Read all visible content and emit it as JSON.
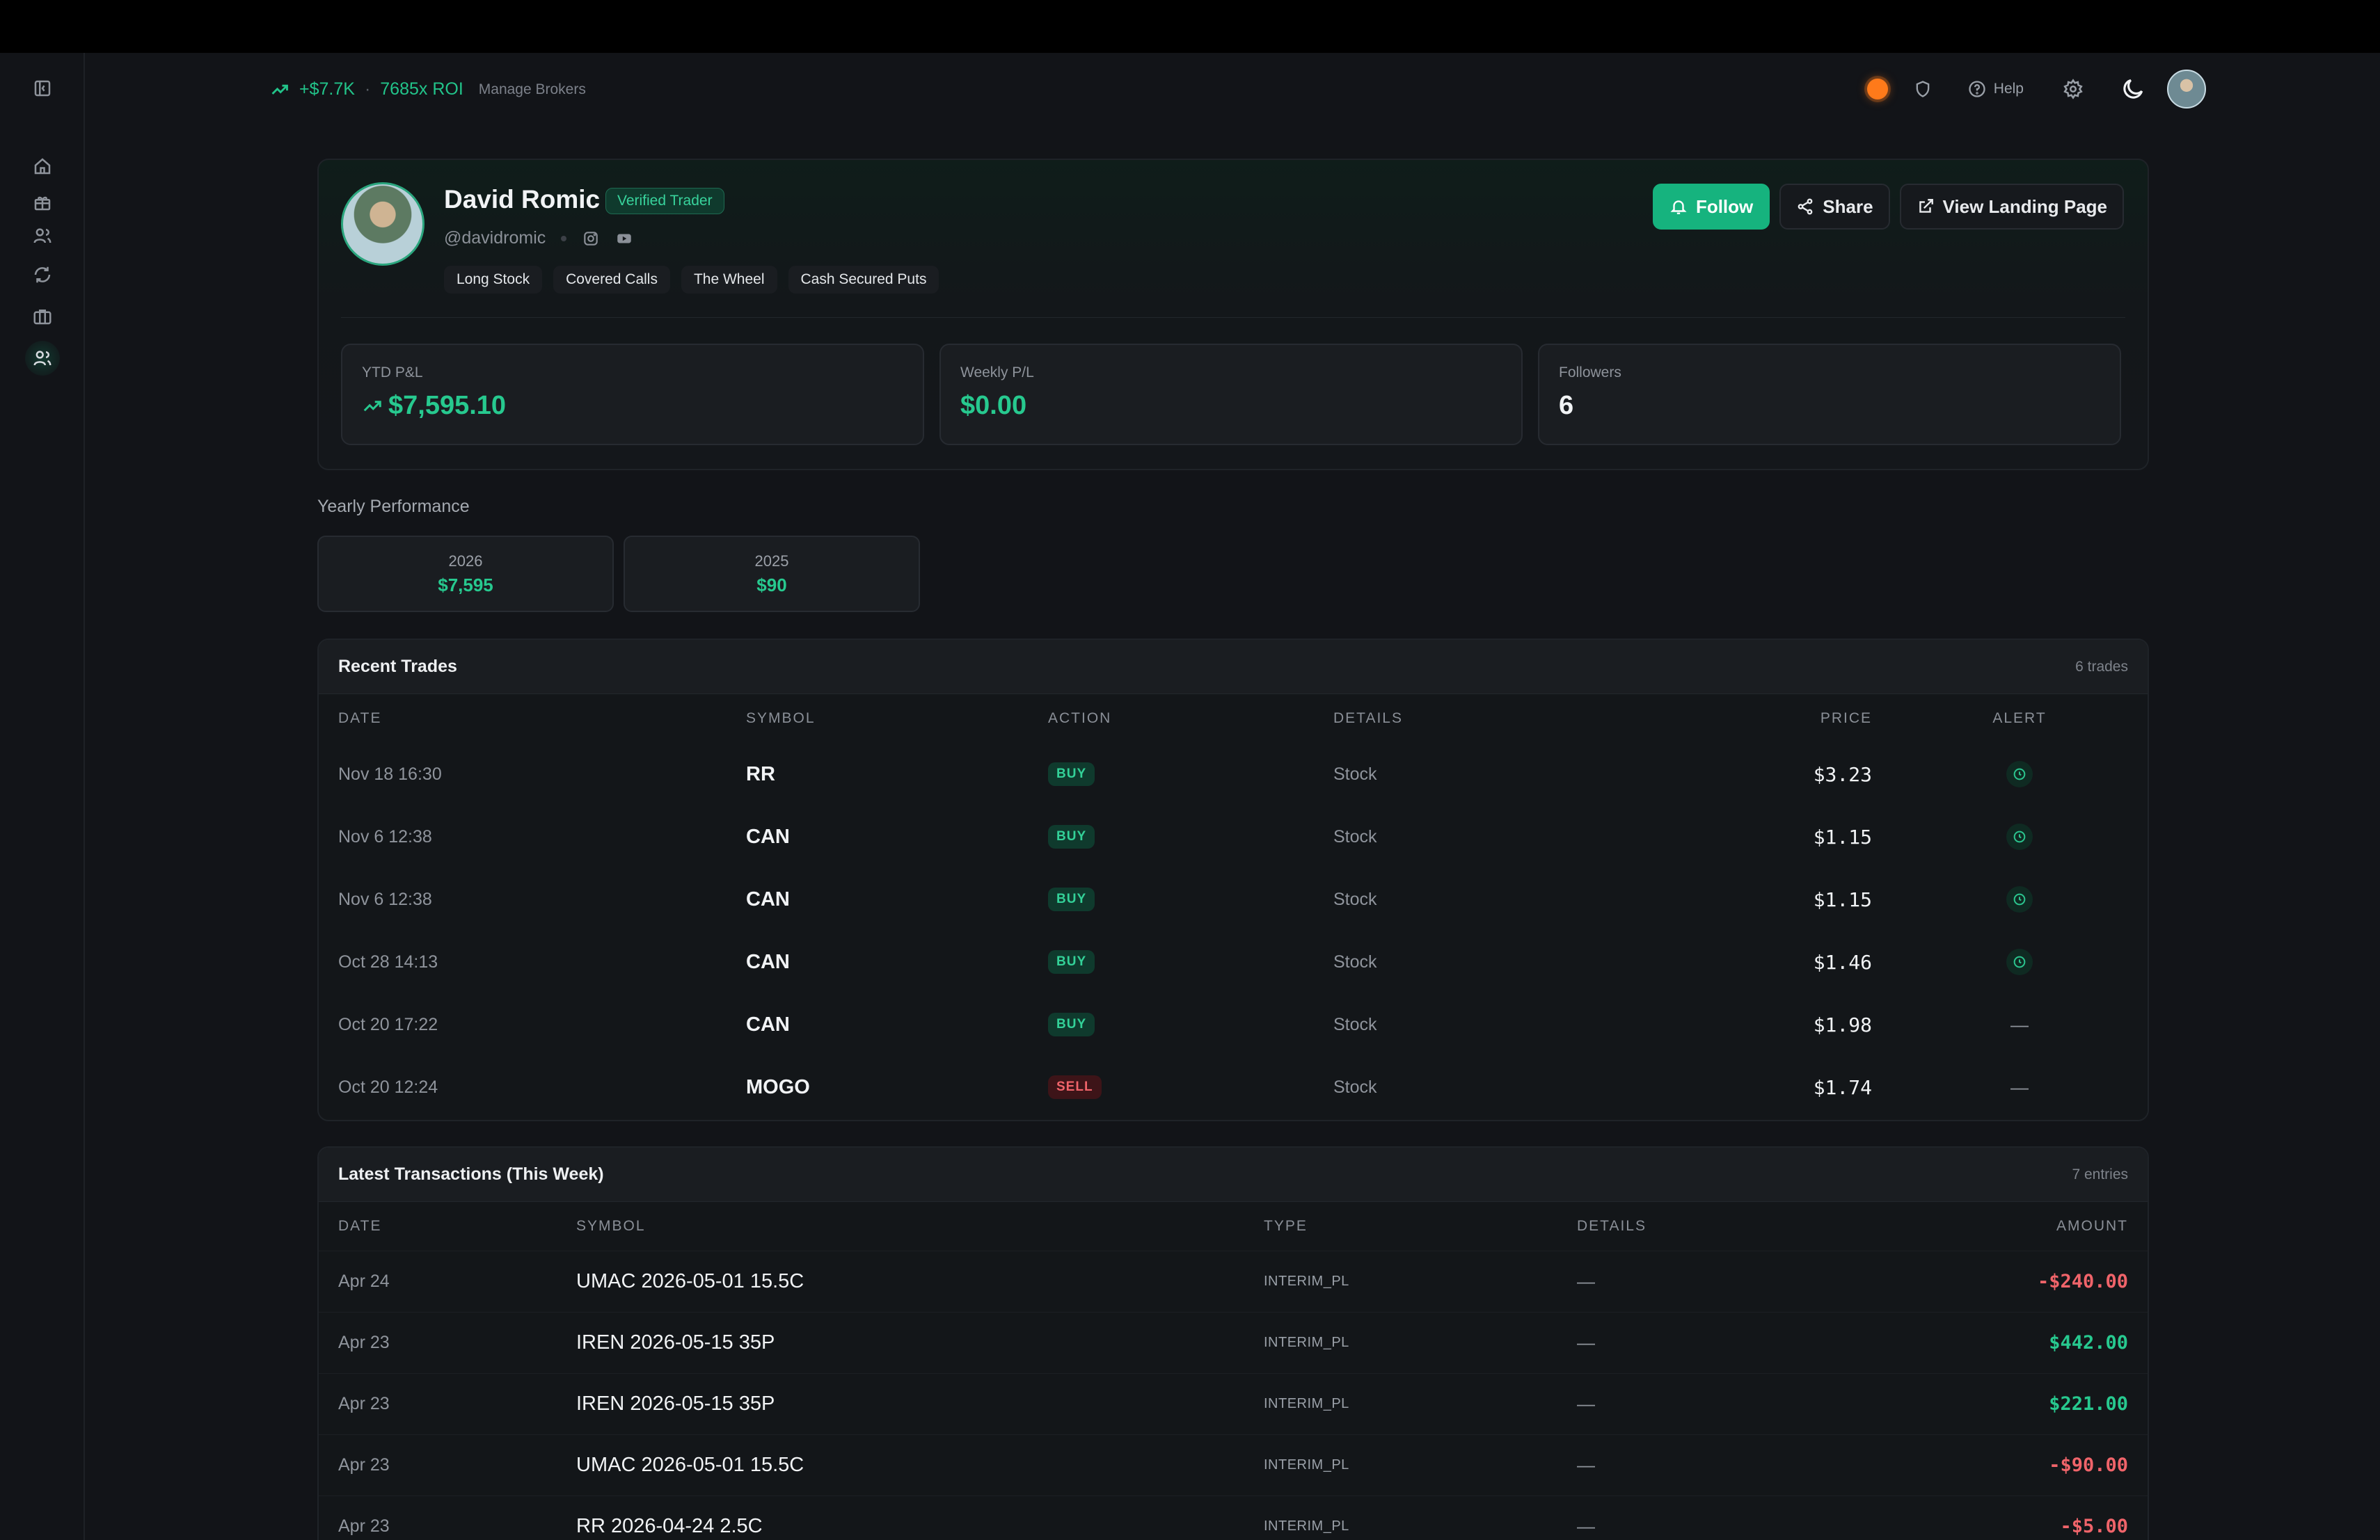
{
  "header": {
    "pnl": "+$7.7K",
    "dot": "·",
    "roi": "7685x ROI",
    "manage_brokers": "Manage Brokers",
    "help": "Help"
  },
  "profile": {
    "name": "David Romic",
    "verified": "Verified Trader",
    "handle": "@davidromic",
    "tags": [
      "Long Stock",
      "Covered Calls",
      "The Wheel",
      "Cash Secured Puts"
    ],
    "follow": "Follow",
    "share": "Share",
    "landing": "View Landing Page"
  },
  "stats": {
    "ytd_label": "YTD P&L",
    "ytd_value": "$7,595.10",
    "weekly_label": "Weekly P/L",
    "weekly_value": "$0.00",
    "followers_label": "Followers",
    "followers_value": "6"
  },
  "yearly": {
    "title": "Yearly Performance",
    "items": [
      {
        "year": "2026",
        "amount": "$7,595"
      },
      {
        "year": "2025",
        "amount": "$90"
      }
    ]
  },
  "recent_trades": {
    "title": "Recent Trades",
    "count": "6 trades",
    "columns": [
      "DATE",
      "SYMBOL",
      "ACTION",
      "DETAILS",
      "PRICE",
      "ALERT"
    ],
    "rows": [
      {
        "date": "Nov 18 16:30",
        "symbol": "RR",
        "action": "BUY",
        "details": "Stock",
        "price": "$3.23",
        "alert": "clock"
      },
      {
        "date": "Nov 6 12:38",
        "symbol": "CAN",
        "action": "BUY",
        "details": "Stock",
        "price": "$1.15",
        "alert": "clock"
      },
      {
        "date": "Nov 6 12:38",
        "symbol": "CAN",
        "action": "BUY",
        "details": "Stock",
        "price": "$1.15",
        "alert": "clock"
      },
      {
        "date": "Oct 28 14:13",
        "symbol": "CAN",
        "action": "BUY",
        "details": "Stock",
        "price": "$1.46",
        "alert": "clock"
      },
      {
        "date": "Oct 20 17:22",
        "symbol": "CAN",
        "action": "BUY",
        "details": "Stock",
        "price": "$1.98",
        "alert": "—"
      },
      {
        "date": "Oct 20 12:24",
        "symbol": "MOGO",
        "action": "SELL",
        "details": "Stock",
        "price": "$1.74",
        "alert": "—"
      }
    ]
  },
  "transactions": {
    "title": "Latest Transactions (This Week)",
    "count": "7 entries",
    "columns": [
      "DATE",
      "SYMBOL",
      "TYPE",
      "DETAILS",
      "AMOUNT"
    ],
    "rows": [
      {
        "date": "Apr 24",
        "symbol": "UMAC 2026-05-01 15.5C",
        "type": "INTERIM_PL",
        "details": "—",
        "amount": "-$240.00",
        "sign": "neg"
      },
      {
        "date": "Apr 23",
        "symbol": "IREN 2026-05-15 35P",
        "type": "INTERIM_PL",
        "details": "—",
        "amount": "$442.00",
        "sign": "pos"
      },
      {
        "date": "Apr 23",
        "symbol": "IREN 2026-05-15 35P",
        "type": "INTERIM_PL",
        "details": "—",
        "amount": "$221.00",
        "sign": "pos"
      },
      {
        "date": "Apr 23",
        "symbol": "UMAC 2026-05-01 15.5C",
        "type": "INTERIM_PL",
        "details": "—",
        "amount": "-$90.00",
        "sign": "neg"
      },
      {
        "date": "Apr 23",
        "symbol": "RR 2026-04-24 2.5C",
        "type": "INTERIM_PL",
        "details": "—",
        "amount": "-$5.00",
        "sign": "neg"
      }
    ]
  },
  "colors": {
    "accent": "#16b37e",
    "positive": "#27c98f",
    "negative": "#f0646a",
    "warning": "#ff7a1a"
  }
}
